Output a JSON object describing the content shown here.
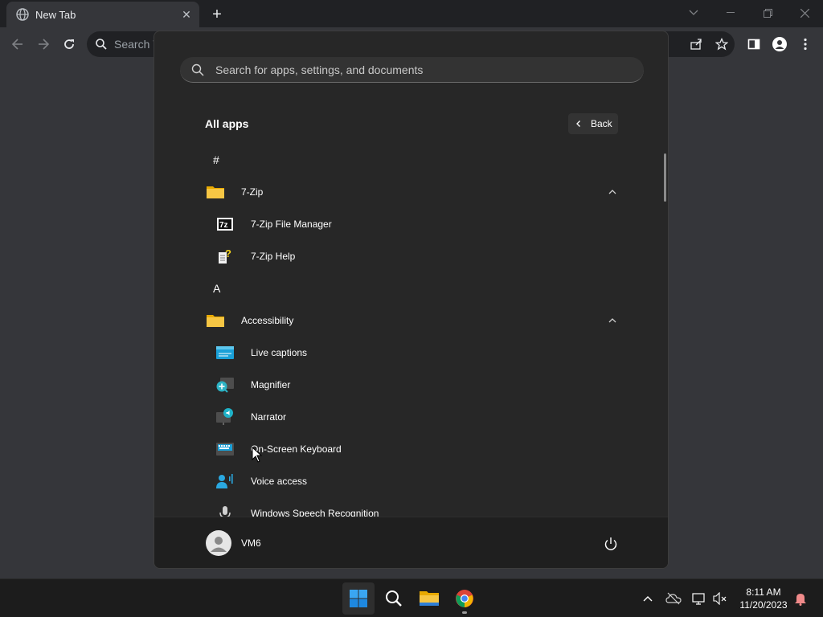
{
  "browser": {
    "tab_title": "New Tab",
    "omnibox_placeholder": "Search Y"
  },
  "start_menu": {
    "search_placeholder": "Search for apps, settings, and documents",
    "section_title": "All apps",
    "back_label": "Back",
    "items": [
      {
        "kind": "letter",
        "text": "#"
      },
      {
        "kind": "folder",
        "text": "7-Zip",
        "icon": "folder-icon"
      },
      {
        "kind": "app",
        "text": "7-Zip File Manager",
        "icon": "7zip-icon"
      },
      {
        "kind": "app",
        "text": "7-Zip Help",
        "icon": "help-file-icon"
      },
      {
        "kind": "letter",
        "text": "A"
      },
      {
        "kind": "folder",
        "text": "Accessibility",
        "icon": "folder-icon"
      },
      {
        "kind": "app",
        "text": "Live captions",
        "icon": "live-captions-icon"
      },
      {
        "kind": "app",
        "text": "Magnifier",
        "icon": "magnifier-icon"
      },
      {
        "kind": "app",
        "text": "Narrator",
        "icon": "narrator-icon"
      },
      {
        "kind": "app",
        "text": "On-Screen Keyboard",
        "icon": "keyboard-icon"
      },
      {
        "kind": "app",
        "text": "Voice access",
        "icon": "voice-access-icon"
      },
      {
        "kind": "app",
        "text": "Windows Speech Recognition",
        "icon": "microphone-icon"
      }
    ],
    "user_name": "VM6"
  },
  "taskbar": {
    "time": "8:11 AM",
    "date": "11/20/2023"
  },
  "colors": {
    "start_bg": "#272727",
    "accent_blue": "#0078d4",
    "folder_yellow": "#f2c12e"
  }
}
